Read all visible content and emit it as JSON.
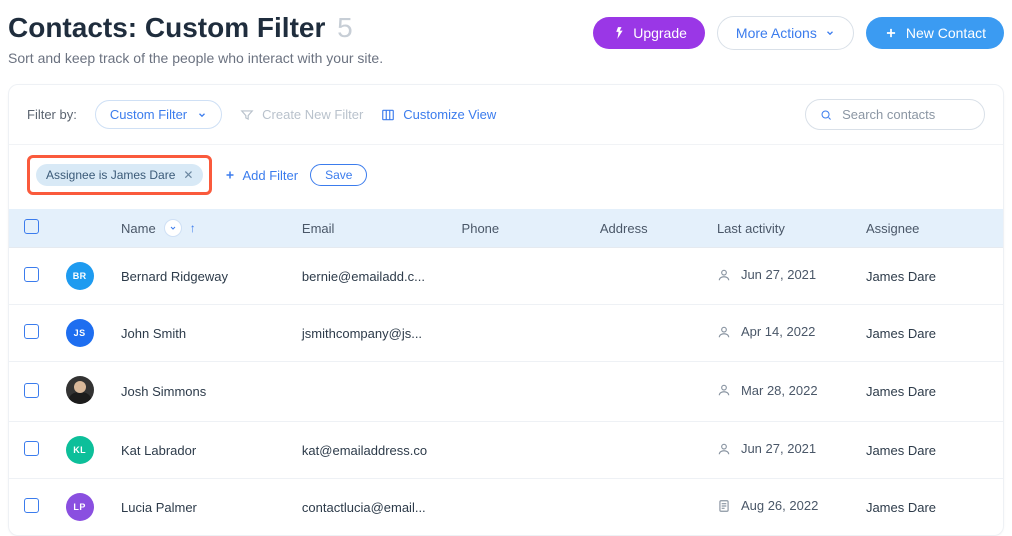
{
  "header": {
    "title_prefix": "Contacts: ",
    "title_main": "Custom Filter",
    "count": "5",
    "subtitle": "Sort and keep track of the people who interact with your site.",
    "upgrade_label": "Upgrade",
    "more_actions_label": "More Actions",
    "new_contact_label": "New Contact"
  },
  "filter_bar": {
    "filter_by_label": "Filter by:",
    "filter_dropdown_label": "Custom Filter",
    "create_new_filter_label": "Create New Filter",
    "customize_view_label": "Customize View",
    "search_placeholder": "Search contacts"
  },
  "applied": {
    "chip_label": "Assignee is James Dare",
    "add_filter_label": "Add Filter",
    "save_label": "Save"
  },
  "columns": {
    "name": "Name",
    "email": "Email",
    "phone": "Phone",
    "address": "Address",
    "last_activity": "Last activity",
    "assignee": "Assignee"
  },
  "rows": [
    {
      "initials": "BR",
      "avatar_color": "#1e9bf0",
      "avatar_type": "initials",
      "name": "Bernard Ridgeway",
      "email": "bernie@emailadd.c...",
      "phone": "",
      "address": "",
      "activity_icon": "person",
      "last_activity": "Jun 27, 2021",
      "assignee": "James Dare"
    },
    {
      "initials": "JS",
      "avatar_color": "#1e6ef0",
      "avatar_type": "initials",
      "name": "John Smith",
      "email": "jsmithcompany@js...",
      "phone": "",
      "address": "",
      "activity_icon": "person",
      "last_activity": "Apr 14, 2022",
      "assignee": "James Dare"
    },
    {
      "initials": "",
      "avatar_color": "#333333",
      "avatar_type": "photo",
      "name": "Josh Simmons",
      "email": "",
      "phone": "",
      "address": "",
      "activity_icon": "person",
      "last_activity": "Mar 28, 2022",
      "assignee": "James Dare"
    },
    {
      "initials": "KL",
      "avatar_color": "#0dbf9a",
      "avatar_type": "initials",
      "name": "Kat Labrador",
      "email": "kat@emailaddress.co",
      "phone": "",
      "address": "",
      "activity_icon": "person",
      "last_activity": "Jun 27, 2021",
      "assignee": "James Dare"
    },
    {
      "initials": "LP",
      "avatar_color": "#8a4fe0",
      "avatar_type": "initials",
      "name": "Lucia Palmer",
      "email": "contactlucia@email...",
      "phone": "",
      "address": "",
      "activity_icon": "form",
      "last_activity": "Aug 26, 2022",
      "assignee": "James Dare"
    }
  ]
}
